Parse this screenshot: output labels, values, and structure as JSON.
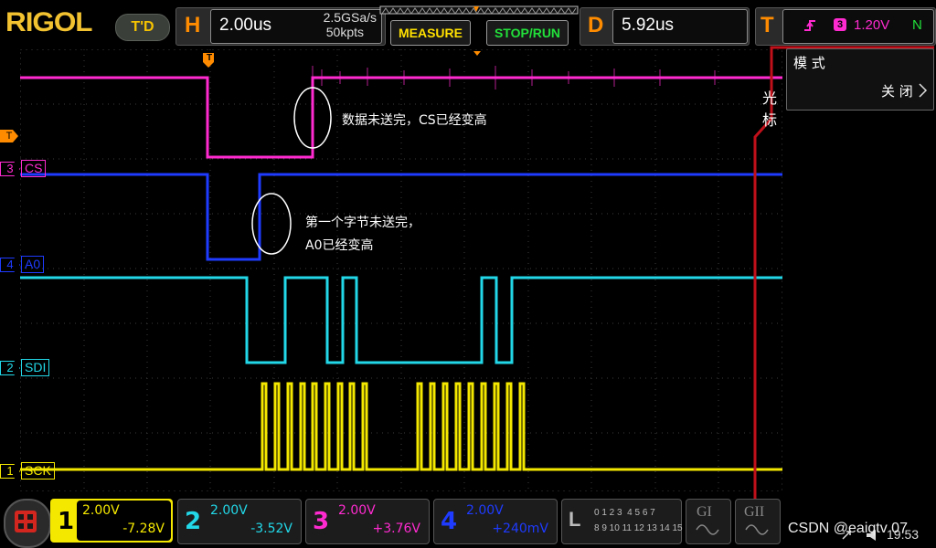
{
  "top": {
    "logo": "RIGOL",
    "mode_pill": "T'D",
    "h_letter": "H",
    "h_value": "2.00us",
    "sample_rate": "2.5GSa/s",
    "mem_depth": "50kpts",
    "measure_btn": "MEASURE",
    "stoprun_btn": "STOP/RUN",
    "d_letter": "D",
    "d_value": "5.92us",
    "t_letter": "T",
    "trig_source": "3",
    "trig_level": "1.20V",
    "trig_mode": "N"
  },
  "channels": [
    {
      "marker": "3",
      "label": "CS",
      "color": "#ff2bd0"
    },
    {
      "marker": "4",
      "label": "A0",
      "color": "#1e3bff"
    },
    {
      "marker": "2",
      "label": "SDI",
      "color": "#22d8e8"
    },
    {
      "marker": "1",
      "label": "SCK",
      "color": "#f5e800"
    }
  ],
  "trig_marker": "T",
  "trig_top_marker": "T",
  "annotations": {
    "note1": "数据未送完，CS已经变高",
    "note2_line1": "第一个字节未送完，",
    "note2_line2": "A0已经变高"
  },
  "side": {
    "menu_title": "光标",
    "mode_label": "模 式",
    "mode_value": "关 闭"
  },
  "bottom": {
    "ch1": {
      "num": "1",
      "scale": "2.00V",
      "offset": "-7.28V"
    },
    "ch2": {
      "num": "2",
      "scale": "2.00V",
      "offset": "-3.52V"
    },
    "ch3": {
      "num": "3",
      "scale": "2.00V",
      "offset": "+3.76V"
    },
    "ch4": {
      "num": "4",
      "scale": "2.00V",
      "offset": "+240mV"
    },
    "logic_letter": "L",
    "logic_row1": "0 1 2 3  4 5 6 7",
    "logic_row2": "8 9 10 11 12 13 14 15",
    "g1": "GI",
    "g2": "GII",
    "time": "19:53",
    "watermark": "CSDN @eaiqtv 07"
  }
}
